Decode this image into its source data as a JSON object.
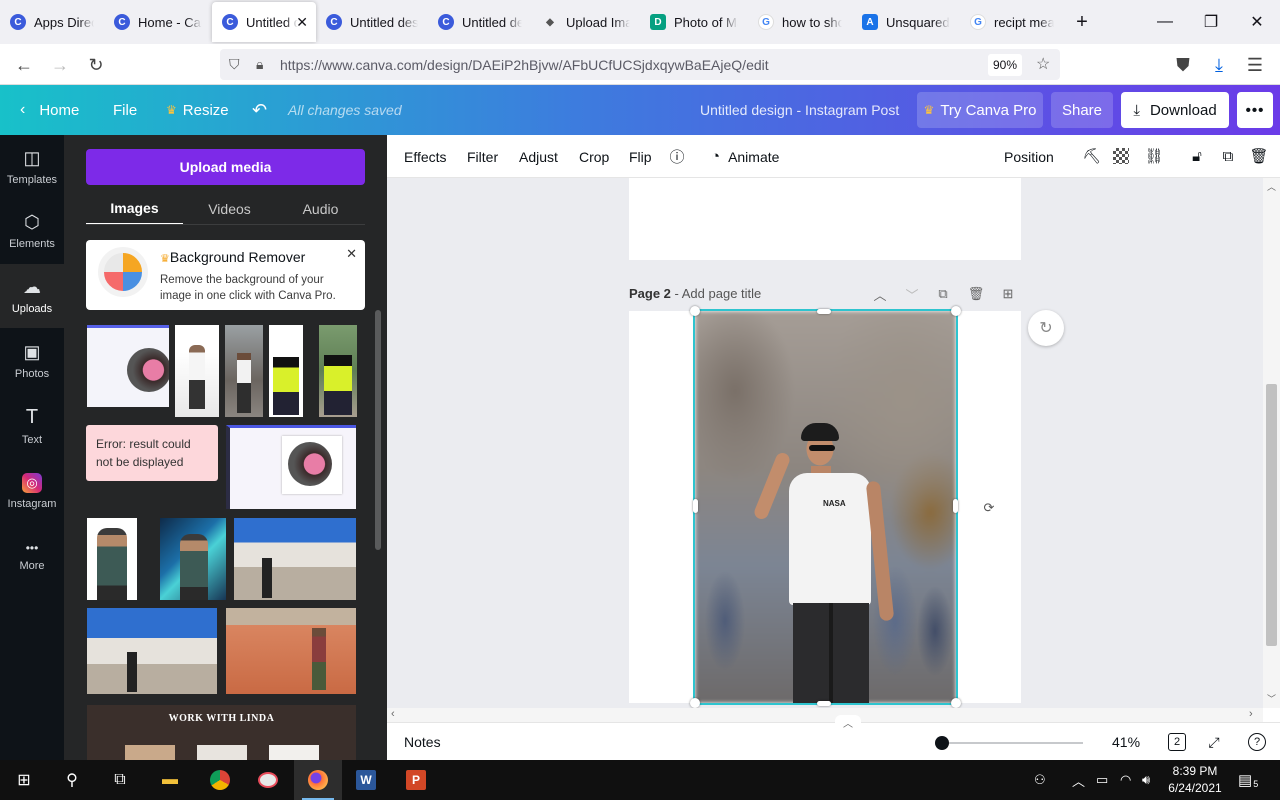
{
  "browser": {
    "tabs": [
      {
        "label": "Apps Directory",
        "fav_color": "#3b5bdb",
        "fav_glyph": "C"
      },
      {
        "label": "Home - Canva",
        "fav_color": "#3b5bdb",
        "fav_glyph": "C"
      },
      {
        "label": "Untitled design",
        "fav_color": "#3b5bdb",
        "fav_glyph": "C",
        "active": true
      },
      {
        "label": "Untitled design",
        "fav_color": "#3b5bdb",
        "fav_glyph": "C"
      },
      {
        "label": "Untitled design",
        "fav_color": "#3b5bdb",
        "fav_glyph": "C"
      },
      {
        "label": "Upload Images",
        "fav_color": "#555555",
        "fav_glyph": "◆"
      },
      {
        "label": "Photo of Man",
        "fav_color": "#05a081",
        "fav_glyph": "D"
      },
      {
        "label": "how to show",
        "fav_color": "#4285f4",
        "fav_glyph": "G"
      },
      {
        "label": "Unsquared",
        "fav_color": "#1a73e8",
        "fav_glyph": "A"
      },
      {
        "label": "recipt meaning",
        "fav_color": "#4285f4",
        "fav_glyph": "G"
      }
    ],
    "url": "https://www.canva.com/design/DAEiP2hBjvw/AFbUCfUCSjdxqywBaEAjeQ/edit",
    "zoom": "90%"
  },
  "header": {
    "home": "Home",
    "file": "File",
    "resize": "Resize",
    "saved": "All changes saved",
    "title": "Untitled design - Instagram Post",
    "try_pro": "Try Canva Pro",
    "share": "Share",
    "download": "Download"
  },
  "rail": [
    {
      "label": "Templates",
      "icon": "◫"
    },
    {
      "label": "Elements",
      "icon": "⬡"
    },
    {
      "label": "Uploads",
      "icon": "☁"
    },
    {
      "label": "Photos",
      "icon": "▣"
    },
    {
      "label": "Text",
      "icon": "T"
    },
    {
      "label": "Instagram",
      "icon": "◎"
    },
    {
      "label": "More",
      "icon": "•••"
    }
  ],
  "panel": {
    "upload_label": "Upload media",
    "tabs": [
      "Images",
      "Videos",
      "Audio"
    ],
    "promo_title": "Background Remover",
    "promo_desc": "Remove the background of your image in one click with Canva Pro.",
    "error_text": "Error: result could not be displayed",
    "template_text": "WORK WITH LINDA"
  },
  "toolbar": {
    "effects": "Effects",
    "filter": "Filter",
    "adjust": "Adjust",
    "crop": "Crop",
    "flip": "Flip",
    "animate": "Animate",
    "position": "Position"
  },
  "canvas": {
    "page2_label": "Page 2",
    "page2_title_placeholder": "Add page title"
  },
  "bottom": {
    "notes": "Notes",
    "zoom": "41%",
    "zoom_fraction": 0.0,
    "page_count": "2"
  },
  "taskbar": {
    "time": "8:39 PM",
    "date": "6/24/2021",
    "notifications": "5"
  },
  "colors": {
    "accent": "#7d2ae8",
    "selection": "#2ec4cf"
  }
}
